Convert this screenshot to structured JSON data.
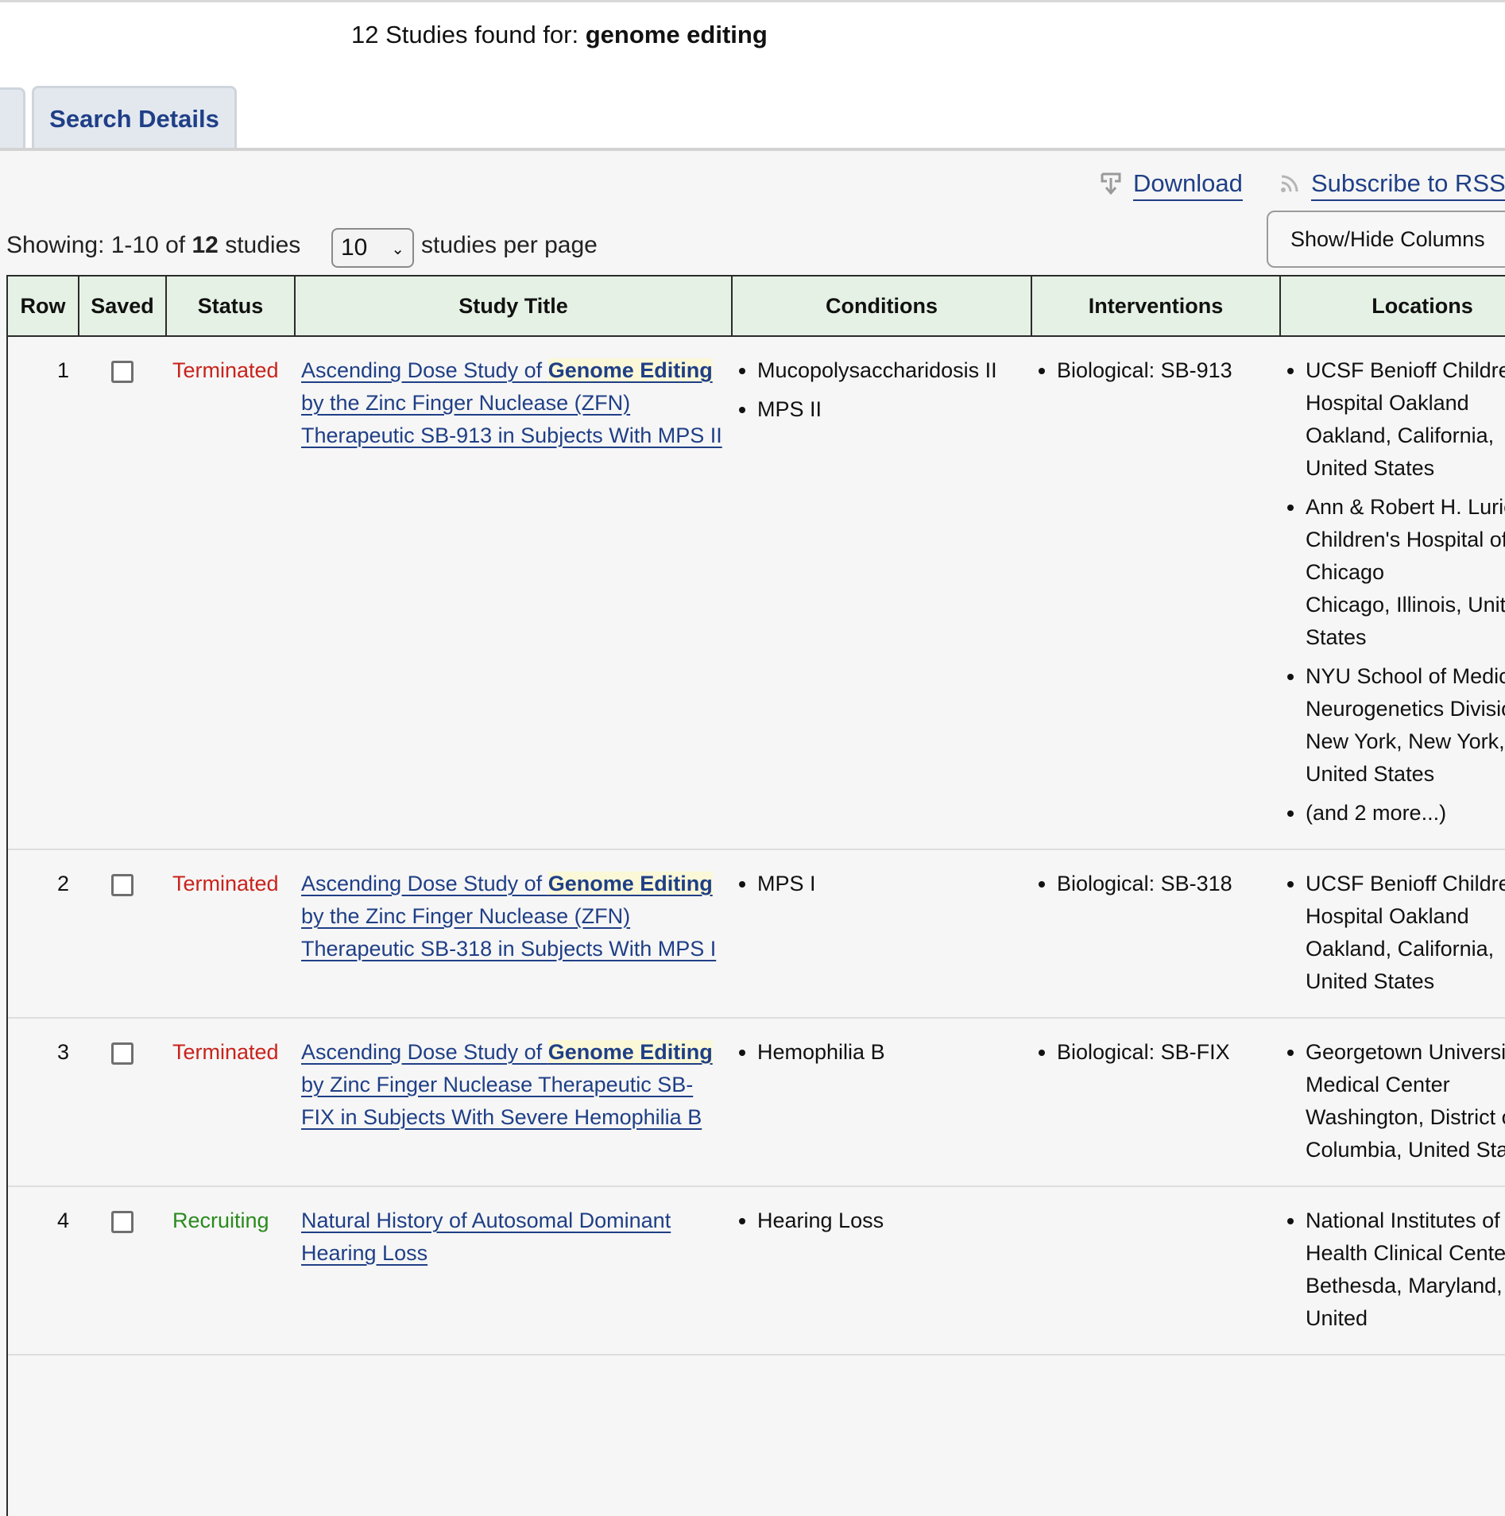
{
  "search": {
    "count_prefix": "12 Studies found for:",
    "term": "genome editing"
  },
  "tabs": [
    {
      "label": "Search Details",
      "active": true
    }
  ],
  "toolbar": {
    "download_label": "Download",
    "download_icon": "download-icon",
    "rss_label": "Subscribe to RSS",
    "rss_icon": "rss-icon",
    "showhide_label": "Show/Hide Columns"
  },
  "paging": {
    "showing_prefix": "Showing: 1-10 of",
    "total": "12",
    "showing_suffix": "studies",
    "per_page_value": "10",
    "per_page_label": "studies per page"
  },
  "table": {
    "headers": [
      "Row",
      "Saved",
      "Status",
      "Study Title",
      "Conditions",
      "Interventions",
      "Locations"
    ],
    "rows": [
      {
        "row": "1",
        "status": "Terminated",
        "status_type": "terminated",
        "title_before": "Ascending Dose Study of ",
        "title_highlight": "Genome Editing",
        "title_after": " by the Zinc Finger Nuclease (ZFN) Therapeutic SB-913 in Subjects With MPS II",
        "conditions": [
          "Mucopolysaccharidosis II",
          "MPS II"
        ],
        "interventions": [
          "Biological: SB-913"
        ],
        "locations": [
          {
            "name": "UCSF Benioff Children's Hospital Oakland",
            "place": "Oakland, California, United States"
          },
          {
            "name": "Ann & Robert H. Lurie Children's Hospital of Chicago",
            "place": "Chicago, Illinois, United States"
          },
          {
            "name": "NYU School of Medicine, Neurogenetics Division",
            "place": "New York, New York, United States"
          },
          {
            "name": "(and 2 more...)",
            "place": ""
          }
        ]
      },
      {
        "row": "2",
        "status": "Terminated",
        "status_type": "terminated",
        "title_before": "Ascending Dose Study of ",
        "title_highlight": "Genome Editing",
        "title_after": " by the Zinc Finger Nuclease (ZFN) Therapeutic SB-318 in Subjects With MPS I",
        "conditions": [
          "MPS I"
        ],
        "interventions": [
          "Biological: SB-318"
        ],
        "locations": [
          {
            "name": "UCSF Benioff Children's Hospital Oakland",
            "place": "Oakland, California, United States"
          }
        ]
      },
      {
        "row": "3",
        "status": "Terminated",
        "status_type": "terminated",
        "title_before": "Ascending Dose Study of ",
        "title_highlight": "Genome Editing",
        "title_after": " by Zinc Finger Nuclease Therapeutic SB-FIX in Subjects With Severe Hemophilia B",
        "conditions": [
          "Hemophilia B"
        ],
        "interventions": [
          "Biological: SB-FIX"
        ],
        "locations": [
          {
            "name": "Georgetown University Medical Center",
            "place": "Washington, District of Columbia, United States"
          }
        ]
      },
      {
        "row": "4",
        "status": "Recruiting",
        "status_type": "recruiting",
        "title_before": "Natural History of Autosomal Dominant Hearing Loss",
        "title_highlight": "",
        "title_after": "",
        "conditions": [
          "Hearing Loss"
        ],
        "interventions": [],
        "locations": [
          {
            "name": "National Institutes of Health Clinical Center",
            "place": "Bethesda, Maryland, United"
          }
        ]
      }
    ]
  }
}
